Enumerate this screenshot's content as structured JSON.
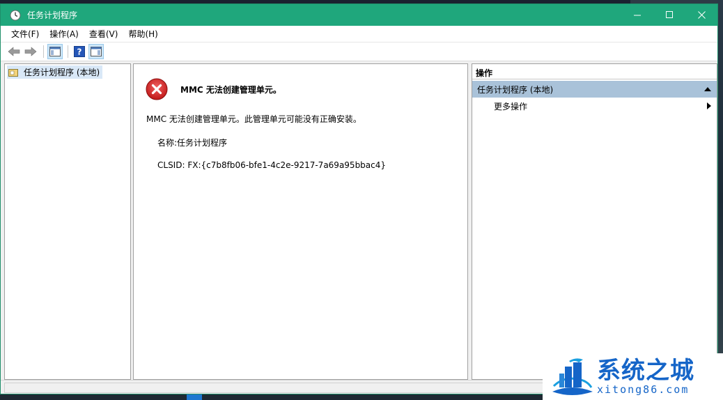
{
  "window": {
    "title": "任务计划程序",
    "controls": {
      "minimize": "—",
      "maximize": "□",
      "close": "✕"
    }
  },
  "menu": {
    "items": [
      {
        "label": "文件(F)"
      },
      {
        "label": "操作(A)"
      },
      {
        "label": "查看(V)"
      },
      {
        "label": "帮助(H)"
      }
    ]
  },
  "toolbar": {
    "buttons": [
      "back-arrow-icon",
      "forward-arrow-icon",
      "show-hide-console-tree-icon",
      "help-icon",
      "show-hide-action-pane-icon"
    ]
  },
  "tree": {
    "selected_item": "任务计划程序 (本地)"
  },
  "content": {
    "error_title": "MMC 无法创建管理单元。",
    "error_message": "MMC 无法创建管理单元。此管理单元可能没有正确安装。",
    "name_line": "名称:任务计划程序",
    "clsid_line": "CLSID: FX:{c7b8fb06-bfe1-4c2e-9217-7a69a95bbac4}"
  },
  "actions": {
    "header": "操作",
    "section_title": "任务计划程序 (本地)",
    "more_actions": "更多操作"
  },
  "watermark": {
    "name": "系统之城",
    "url": "xitong86.com"
  },
  "colors": {
    "titlebar": "#1fa77c",
    "selection": "#d9e8f7",
    "actions_section": "#a9c2d9",
    "watermark_blue": "#1565c8"
  }
}
